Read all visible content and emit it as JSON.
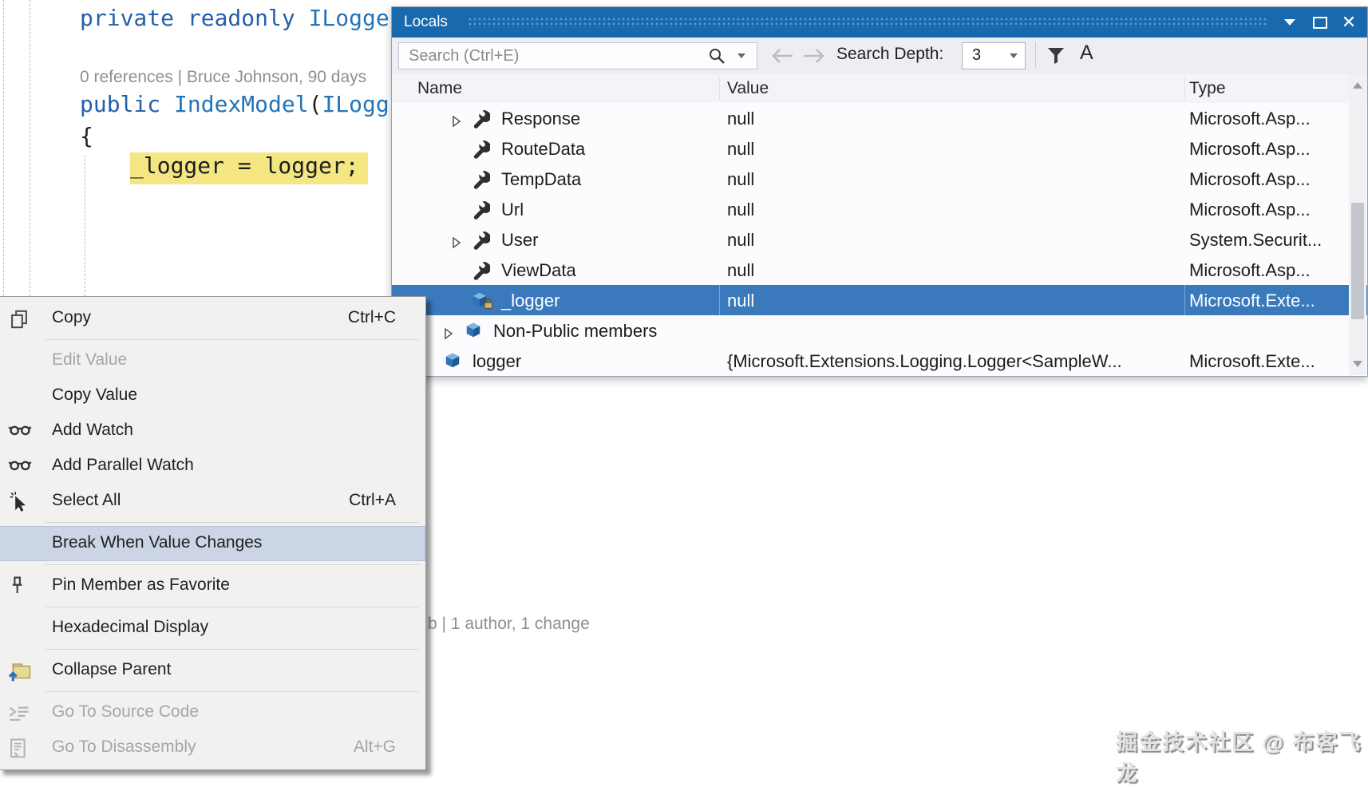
{
  "colors": {
    "titlebar_blue": "#1969af",
    "selection_blue": "#3a7abc",
    "menu_highlight": "#ccd5e5",
    "code_highlight_yellow": "#f4e682",
    "keyword_blue": "#235faa",
    "type_blue": "#2573b8",
    "codelens_gray": "#8f8f8f"
  },
  "editor": {
    "line1_keywords": "private readonly ",
    "line1_type": "ILogge",
    "codelens1": "0 references | Bruce Johnson, 90 days",
    "line2_keyword": "public ",
    "line2_method": "IndexModel",
    "line2_paren": "(",
    "line2_type": "ILogg",
    "line3_brace": "{",
    "highlighted_statement": "_logger = logger;",
    "codelens2": "b | 1 author, 1 change",
    "watermark": "掘金技术社区 @ 布客飞龙"
  },
  "locals_window": {
    "title": "Locals",
    "search_placeholder": "Search (Ctrl+E)",
    "search_depth_label": "Search Depth:",
    "search_depth_value": "3",
    "match_case_label": "A",
    "columns": [
      "Name",
      "Value",
      "Type"
    ],
    "rows": [
      {
        "name": "Response",
        "value": "null",
        "type": "Microsoft.Asp...",
        "icon": "wrench",
        "arrow": true,
        "level": 1,
        "selected": false
      },
      {
        "name": "RouteData",
        "value": "null",
        "type": "Microsoft.Asp...",
        "icon": "wrench",
        "arrow": false,
        "level": 1,
        "selected": false
      },
      {
        "name": "TempData",
        "value": "null",
        "type": "Microsoft.Asp...",
        "icon": "wrench",
        "arrow": false,
        "level": 1,
        "selected": false
      },
      {
        "name": "Url",
        "value": "null",
        "type": "Microsoft.Asp...",
        "icon": "wrench",
        "arrow": false,
        "level": 1,
        "selected": false
      },
      {
        "name": "User",
        "value": "null",
        "type": "System.Securit...",
        "icon": "wrench",
        "arrow": true,
        "level": 1,
        "selected": false
      },
      {
        "name": "ViewData",
        "value": "null",
        "type": "Microsoft.Asp...",
        "icon": "wrench",
        "arrow": false,
        "level": 1,
        "selected": false
      },
      {
        "name": "_logger",
        "value": "null",
        "type": "Microsoft.Exte...",
        "icon": "cube-lock",
        "arrow": false,
        "level": 1,
        "selected": true
      },
      {
        "name": "Non-Public members",
        "value": "",
        "type": "",
        "icon": "cube",
        "arrow": true,
        "level": 0,
        "selected": false
      },
      {
        "name": "logger",
        "value": "{Microsoft.Extensions.Logging.Logger<SampleW...",
        "type": "Microsoft.Exte...",
        "icon": "cube",
        "arrow": false,
        "level": 0,
        "selected": false
      }
    ]
  },
  "context_menu": {
    "items": [
      {
        "label": "Copy",
        "shortcut": "Ctrl+C",
        "icon": "copy"
      },
      {
        "separator": true
      },
      {
        "label": "Edit Value",
        "disabled": true
      },
      {
        "label": "Copy Value"
      },
      {
        "label": "Add Watch",
        "icon": "glasses"
      },
      {
        "label": "Add Parallel Watch",
        "icon": "glasses"
      },
      {
        "label": "Select All",
        "shortcut": "Ctrl+A",
        "icon": "select-all"
      },
      {
        "separator": true
      },
      {
        "label": "Break When Value Changes",
        "highlighted": true
      },
      {
        "separator": true
      },
      {
        "label": "Pin Member as Favorite",
        "icon": "pin"
      },
      {
        "separator": true
      },
      {
        "label": "Hexadecimal Display"
      },
      {
        "separator": true
      },
      {
        "label": "Collapse Parent",
        "icon": "collapse"
      },
      {
        "separator": true
      },
      {
        "label": "Go To Source Code",
        "disabled": true,
        "icon": "goto-source"
      },
      {
        "label": "Go To Disassembly",
        "shortcut": "Alt+G",
        "disabled": true,
        "icon": "goto-disasm"
      }
    ]
  }
}
